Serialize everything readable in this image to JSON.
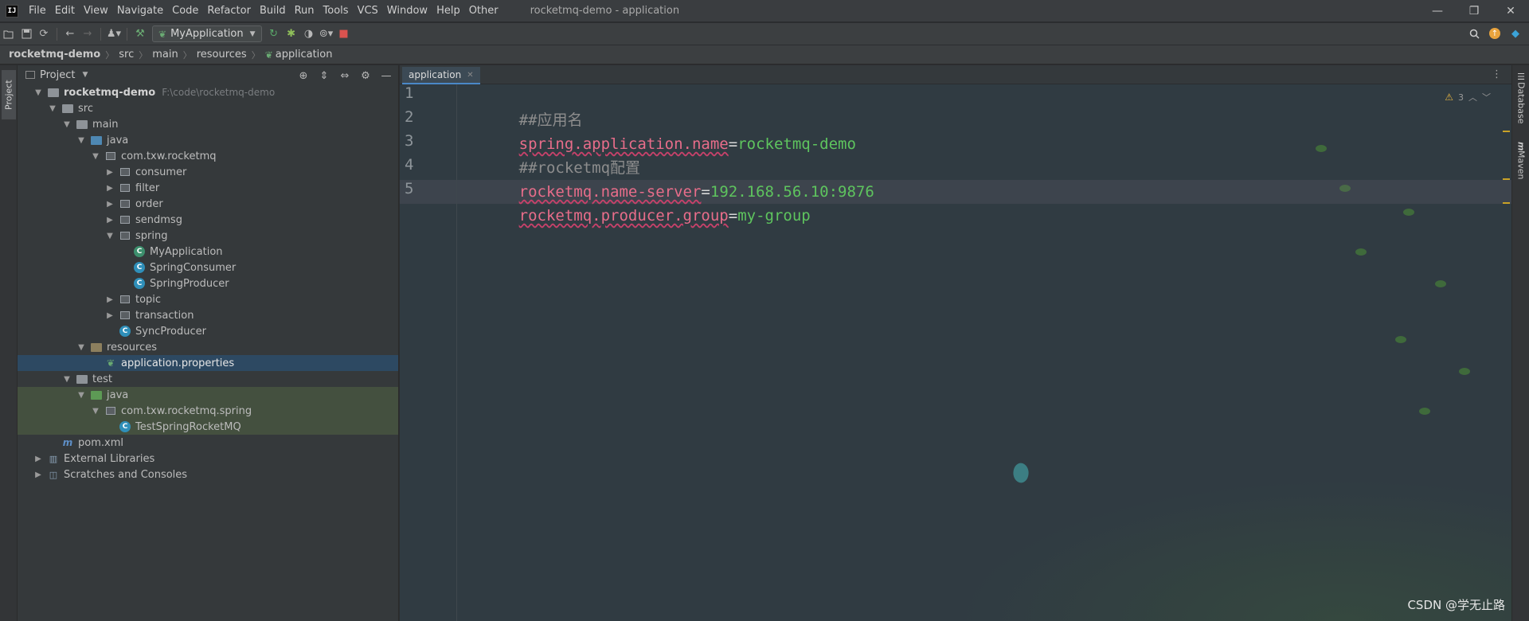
{
  "app": {
    "logo": "IJ",
    "window_title": "rocketmq-demo - application"
  },
  "menu": [
    "File",
    "Edit",
    "View",
    "Navigate",
    "Code",
    "Refactor",
    "Build",
    "Run",
    "Tools",
    "VCS",
    "Window",
    "Help",
    "Other"
  ],
  "window_controls": {
    "minimize": "—",
    "restore": "❐",
    "close": "✕"
  },
  "toolbar": {
    "run_config": "MyApplication"
  },
  "breadcrumb": [
    "rocketmq-demo",
    "src",
    "main",
    "resources",
    "application"
  ],
  "left_stripe": {
    "project_tab": "Project"
  },
  "project_panel": {
    "title": "Project"
  },
  "tree": {
    "root": {
      "label": "rocketmq-demo",
      "path": "F:\\code\\rocketmq-demo"
    },
    "src": "src",
    "main": "main",
    "java": "java",
    "pkg": "com.txw.rocketmq",
    "consumer": "consumer",
    "filter": "filter",
    "order": "order",
    "sendmsg": "sendmsg",
    "spring": "spring",
    "my_application": "MyApplication",
    "spring_consumer": "SpringConsumer",
    "spring_producer": "SpringProducer",
    "topic": "topic",
    "transaction": "transaction",
    "sync_producer": "SyncProducer",
    "resources": "resources",
    "app_props": "application.properties",
    "test": "test",
    "test_java": "java",
    "test_pkg": "com.txw.rocketmq.spring",
    "test_class": "TestSpringRocketMQ",
    "pom": "pom.xml",
    "ext_libs": "External Libraries",
    "scratches": "Scratches and Consoles"
  },
  "editor": {
    "tab_label": "application",
    "lines": [
      {
        "no": "1",
        "comment": "##应用名"
      },
      {
        "no": "2",
        "key": "spring.application.name",
        "eq": "=",
        "value": "rocketmq-demo"
      },
      {
        "no": "3",
        "comment": "##rocketmq配置"
      },
      {
        "no": "4",
        "key": "rocketmq.name-server",
        "eq": "=",
        "value": "192.168.56.10:9876"
      },
      {
        "no": "5",
        "key": "rocketmq.producer.group",
        "eq": "=",
        "value": "my-group"
      }
    ],
    "warnings_count": "3"
  },
  "right_stripe": {
    "database": "Database",
    "maven": "Maven"
  },
  "watermark": "CSDN @学无止路",
  "colors": {
    "accent": "#4a88c7",
    "key": "#e86d8a",
    "value": "#5ec45e",
    "comment": "#8d8d8d",
    "selection": "#2d4962"
  }
}
